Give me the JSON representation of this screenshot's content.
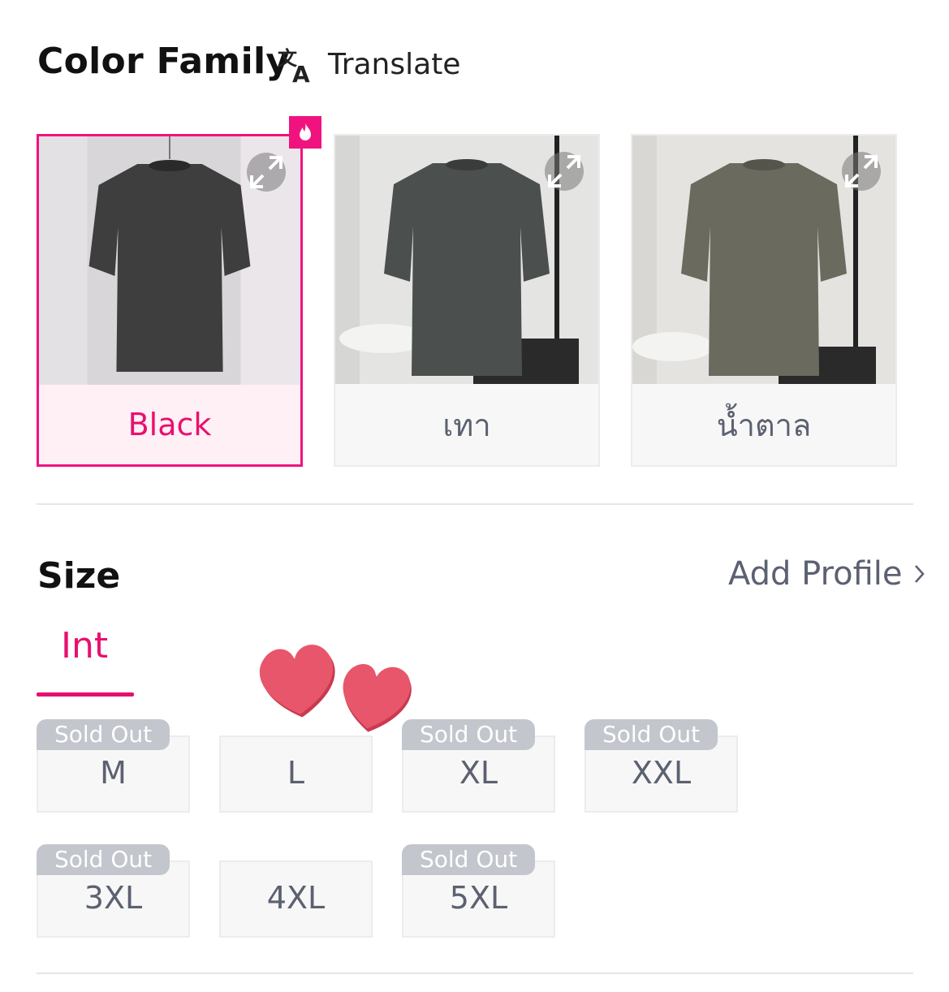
{
  "color_family": {
    "title": "Color Family",
    "translate_label": "Translate",
    "options": [
      {
        "label": "Black",
        "selected": true,
        "hot": true,
        "shirt_color": "#3e3e3f"
      },
      {
        "label": "เทา",
        "selected": false,
        "hot": false,
        "shirt_color": "#4b4f4e"
      },
      {
        "label": "น้ำตาล",
        "selected": false,
        "hot": false,
        "shirt_color": "#6b6a5e"
      }
    ]
  },
  "size": {
    "title": "Size",
    "add_profile_label": "Add Profile",
    "active_tab": "Int",
    "sold_out_label": "Sold Out",
    "options": [
      {
        "label": "M",
        "sold_out": true
      },
      {
        "label": "L",
        "sold_out": false
      },
      {
        "label": "XL",
        "sold_out": true
      },
      {
        "label": "XXL",
        "sold_out": true
      },
      {
        "label": "3XL",
        "sold_out": true
      },
      {
        "label": "4XL",
        "sold_out": false
      },
      {
        "label": "5XL",
        "sold_out": true
      }
    ]
  },
  "colors": {
    "accent": "#e8106f",
    "soldout_badge": "#c3c6cd",
    "heart": "#e8566b"
  }
}
